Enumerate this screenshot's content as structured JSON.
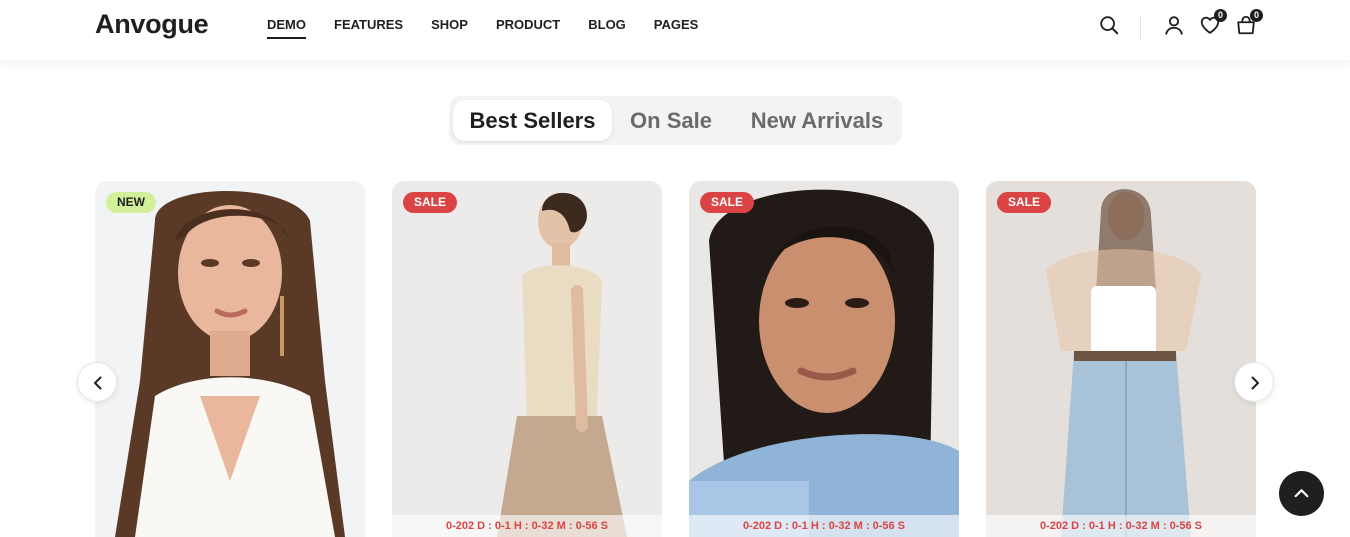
{
  "header": {
    "logo": "Anvogue",
    "nav": [
      {
        "label": "DEMO",
        "active": true
      },
      {
        "label": "FEATURES"
      },
      {
        "label": "SHOP"
      },
      {
        "label": "PRODUCT"
      },
      {
        "label": "BLOG"
      },
      {
        "label": "PAGES"
      }
    ],
    "icons": [
      "search-icon",
      "user-icon",
      "heart-icon",
      "cart-icon"
    ],
    "wishlist_count": "0",
    "cart_count": "0"
  },
  "tabs": [
    {
      "label": "Best Sellers",
      "active": true
    },
    {
      "label": "On Sale"
    },
    {
      "label": "New Arrivals"
    }
  ],
  "products": [
    {
      "badge": "NEW",
      "badge_type": "new",
      "countdown": ""
    },
    {
      "badge": "SALE",
      "badge_type": "sale",
      "countdown": "0-202 D : 0-1 H : 0-32 M : 0-56 S"
    },
    {
      "badge": "SALE",
      "badge_type": "sale",
      "countdown": "0-202 D : 0-1 H : 0-32 M : 0-56 S"
    },
    {
      "badge": "SALE",
      "badge_type": "sale",
      "countdown": "0-202 D : 0-1 H : 0-32 M : 0-56 S"
    }
  ],
  "colors": {
    "accent": "#d2ef9a",
    "sale": "#db4444",
    "dark": "#1f1f1f",
    "tab_bg": "#f3f3f3"
  }
}
